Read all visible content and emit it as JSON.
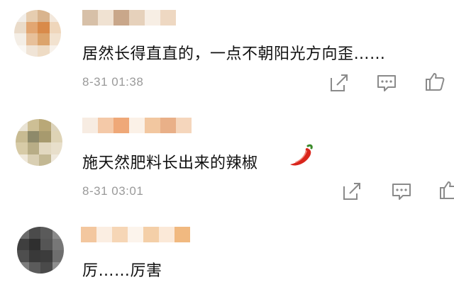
{
  "comments": [
    {
      "text": "居然长得直直的，一点不朝阳光方向歪……",
      "time": "8-31 01:38",
      "avatar_colors": [
        "#f1ede8",
        "#e6cdb0",
        "#d9b48e",
        "#f3e8dc",
        "#eadbc9",
        "#e2a672",
        "#d98a4a",
        "#efd6bb",
        "#f4eee6",
        "#e7c09a",
        "#dca46c",
        "#f2e2cf",
        "#faf7f3",
        "#f0e4d6",
        "#eedbc4",
        "#f8f2eb"
      ],
      "name_colors": [
        "#d7c0a8",
        "#f0e2d2",
        "#c9a78a",
        "#e6d1bb",
        "#f7eee4",
        "#eed8c2"
      ]
    },
    {
      "text": "施天然肥料长出来的辣椒",
      "emoji": "chili-pepper",
      "time": "8-31 03:01",
      "avatar_colors": [
        "#e9e3d4",
        "#cdbf95",
        "#b9a877",
        "#dcd3bb",
        "#c8bb92",
        "#8e8a6a",
        "#a79a6e",
        "#ded3b5",
        "#d7cba7",
        "#b8ad86",
        "#e2d8c0",
        "#e8dfcb",
        "#efe8da",
        "#d9cfb3",
        "#c3b893",
        "#efe9dd"
      ],
      "name_colors": [
        "#f7ece2",
        "#f4c9a8",
        "#efa878",
        "#fbf1e7",
        "#f2c7a0",
        "#e9b088",
        "#f5d6bc"
      ]
    },
    {
      "text": "厉……厉害",
      "avatar_colors": [
        "#6b6b6b",
        "#4b4b4b",
        "#5a5a5a",
        "#8a8a8a",
        "#3f3f3f",
        "#2f2f2f",
        "#555555",
        "#777777",
        "#4e4e4e",
        "#393939",
        "#3c3c3c",
        "#6e6e6e",
        "#7d7d7d",
        "#5b5b5b",
        "#4a4a4a",
        "#8e8e8e"
      ],
      "name_colors": [
        "#f3c79f",
        "#fbeee2",
        "#f6d6b6",
        "#fcf4ec",
        "#f4cfa8",
        "#fbe9d8",
        "#f1b980"
      ]
    }
  ],
  "icons": [
    "share-icon",
    "comment-icon",
    "like-icon"
  ],
  "colors": {
    "text": "#111111",
    "time": "#9a9a9a",
    "icon": "#8a8a8a",
    "chili": "#d9251c"
  }
}
